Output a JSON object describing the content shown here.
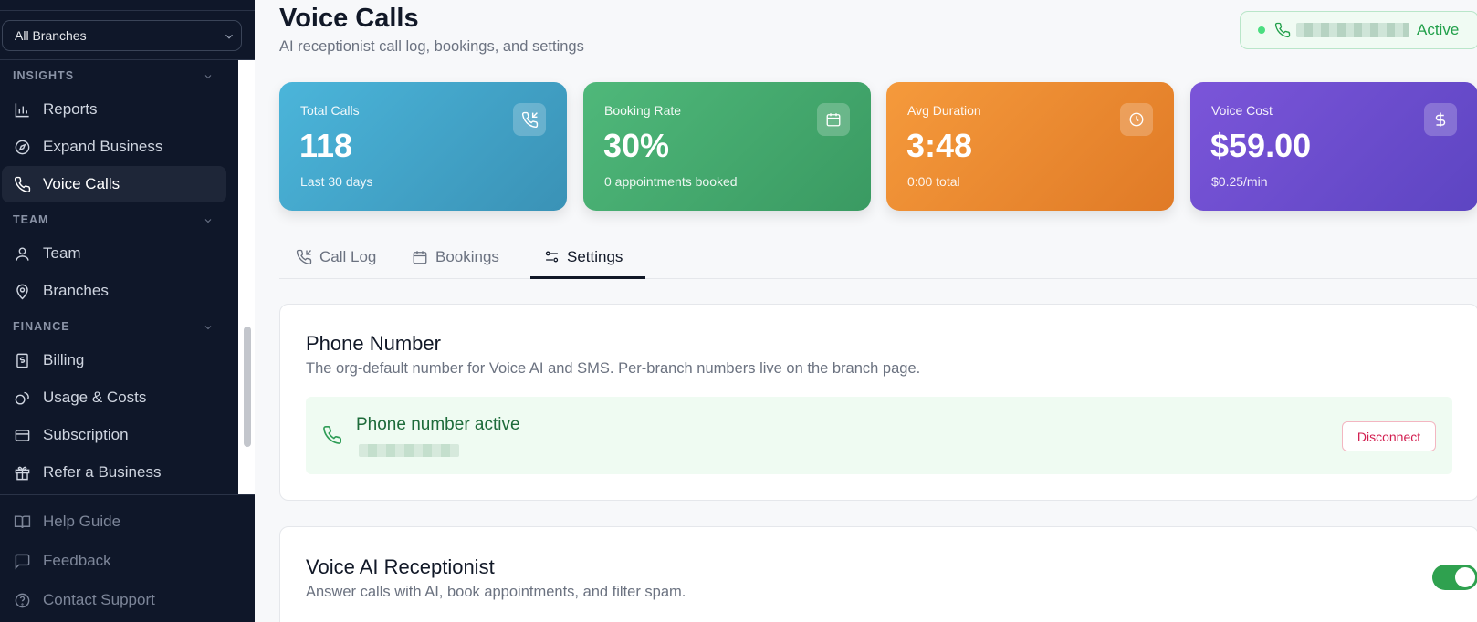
{
  "sidebar": {
    "branch_select": "All Branches",
    "sections": {
      "insights": "INSIGHTS",
      "team": "TEAM",
      "finance": "FINANCE"
    },
    "items": {
      "reports": "Reports",
      "expand_business": "Expand Business",
      "voice_calls": "Voice Calls",
      "team": "Team",
      "branches": "Branches",
      "billing": "Billing",
      "usage_costs": "Usage & Costs",
      "subscription": "Subscription",
      "refer_business": "Refer a Business"
    },
    "bottom": {
      "help_guide": "Help Guide",
      "feedback": "Feedback",
      "contact_support": "Contact Support"
    }
  },
  "header": {
    "title": "Voice Calls",
    "subtitle": "AI receptionist call log, bookings, and settings",
    "status": "Active"
  },
  "stats": {
    "total_calls": {
      "label": "Total Calls",
      "value": "118",
      "sub": "Last 30 days"
    },
    "booking_rate": {
      "label": "Booking Rate",
      "value": "30%",
      "sub": "0 appointments booked"
    },
    "avg_duration": {
      "label": "Avg Duration",
      "value": "3:48",
      "sub": "0:00 total"
    },
    "voice_cost": {
      "label": "Voice Cost",
      "value": "$59.00",
      "sub": "$0.25/min"
    }
  },
  "tabs": {
    "call_log": "Call Log",
    "bookings": "Bookings",
    "settings": "Settings"
  },
  "phone_card": {
    "title": "Phone Number",
    "description": "The org-default number for Voice AI and SMS. Per-branch numbers live on the branch page.",
    "status_title": "Phone number active",
    "disconnect": "Disconnect"
  },
  "receptionist_card": {
    "title": "Voice AI Receptionist",
    "description": "Answer calls with AI, book appointments, and filter spam.",
    "enabled": true
  },
  "colors": {
    "sidebar_bg": "#0f1729",
    "total_calls": "#44a6ca",
    "booking_rate": "#46aa6e",
    "avg_duration": "#ea8a31",
    "voice_cost": "#6c4ecd",
    "active_green": "#22a04b",
    "disconnect_red": "#d21d4f"
  }
}
